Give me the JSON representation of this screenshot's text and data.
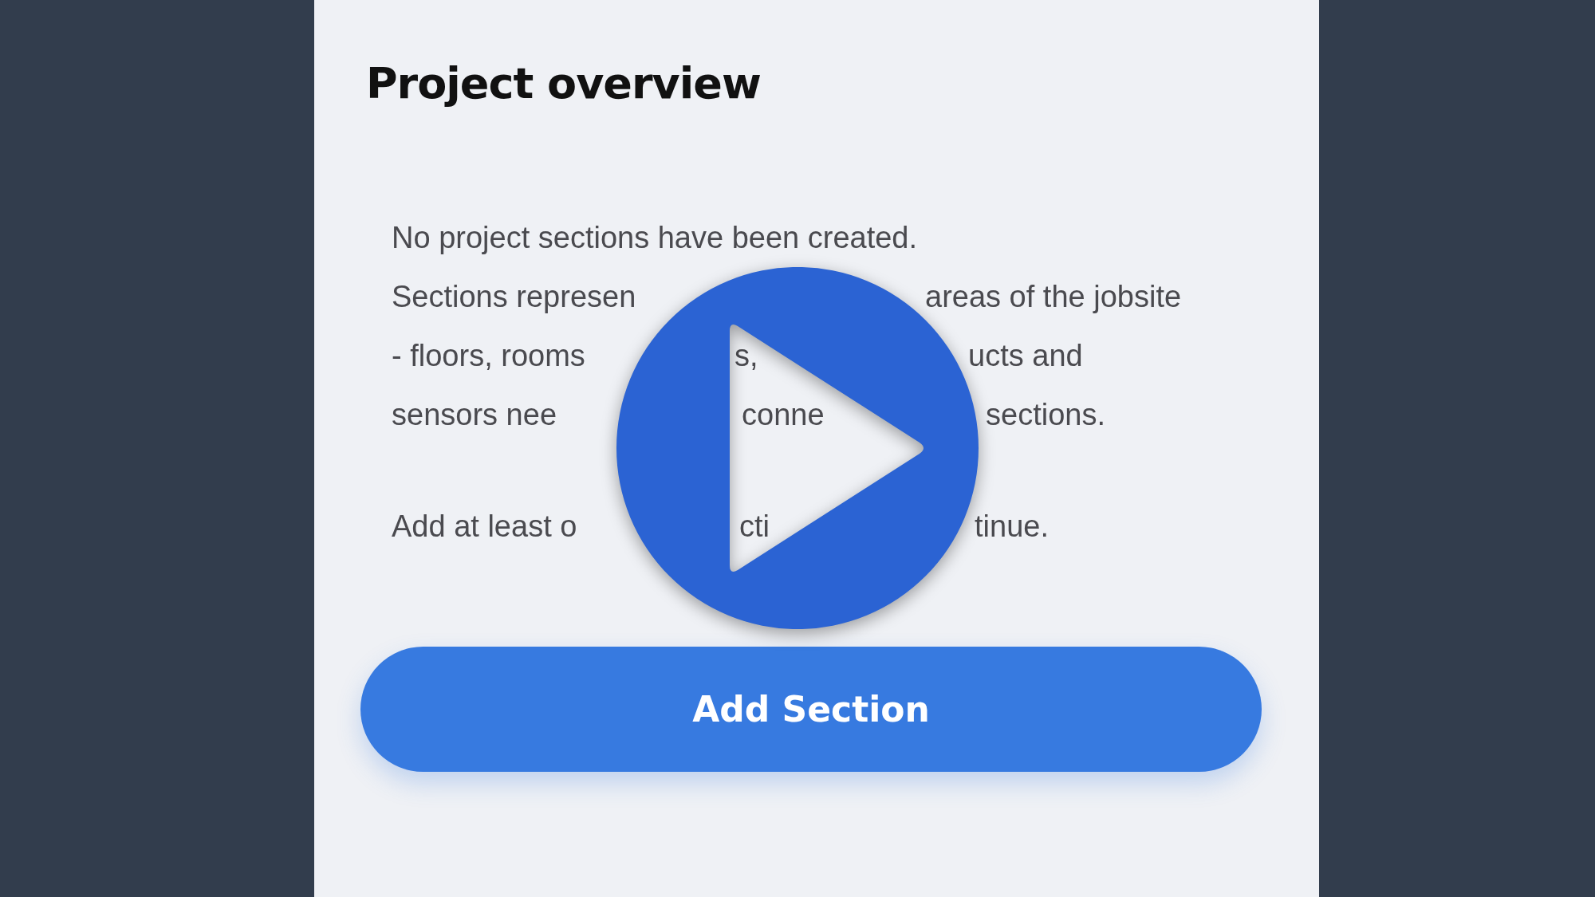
{
  "title": "Project overview",
  "paragraphs": [
    {
      "lines": [
        {
          "left": "No project sections have been created."
        },
        {
          "left": "Sections represen",
          "right": "areas of the jobsite"
        },
        {
          "left": "- floors, rooms",
          "middle": "s,",
          "right": "ucts and"
        },
        {
          "left": "sensors nee",
          "middle": "conne",
          "right": "sections."
        }
      ]
    },
    {
      "lines": [
        {
          "left": "Add at least o",
          "middle": "cti",
          "right": "tinue."
        }
      ]
    }
  ],
  "button": {
    "label": "Add Section"
  }
}
